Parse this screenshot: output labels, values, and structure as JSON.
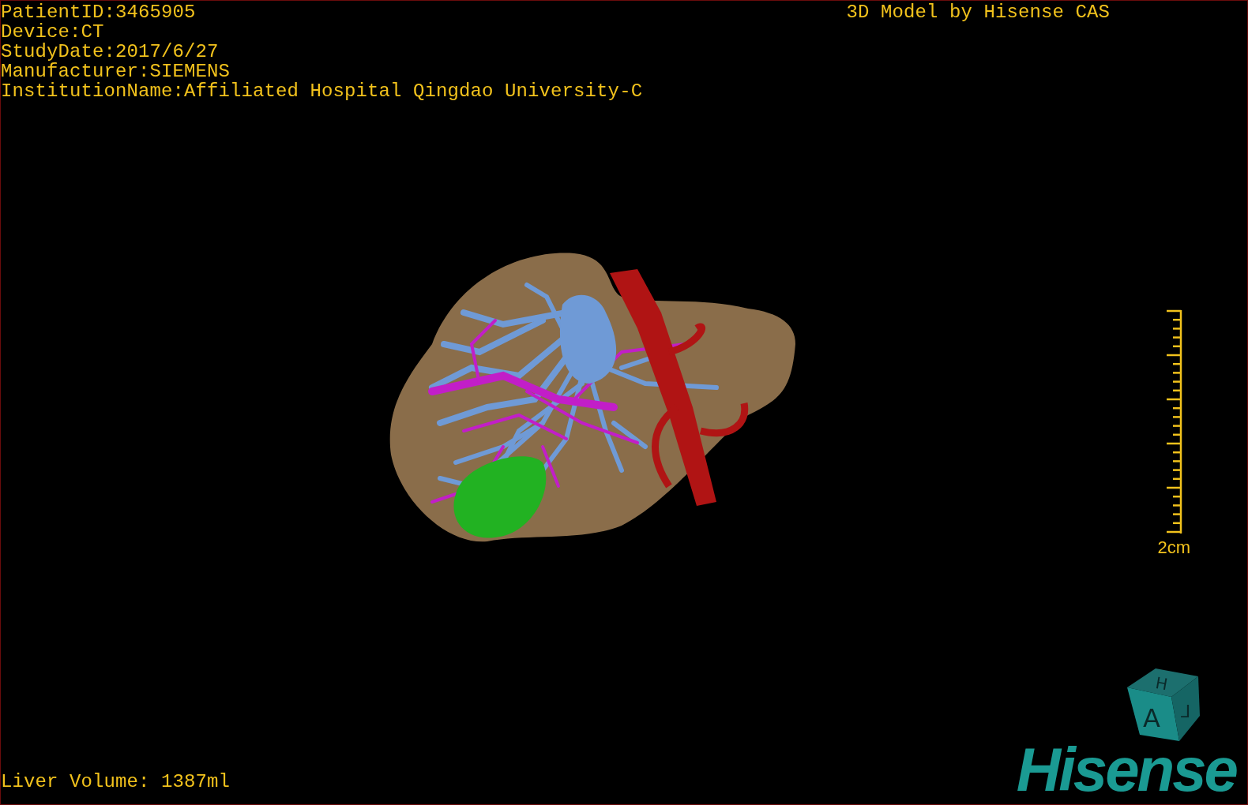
{
  "header": {
    "info_lines": [
      "PatientID:3465905",
      "Device:CT",
      "StudyDate:2017/6/27",
      "Manufacturer:SIEMENS",
      "InstitutionName:Affiliated Hospital Qingdao University-C"
    ],
    "title": "3D Model by Hisense CAS"
  },
  "scale_bar": {
    "label": "2cm"
  },
  "footer": {
    "volume": "Liver Volume: 1387ml"
  },
  "orientation_cube": {
    "top": "H",
    "front": "A",
    "side": "⅃"
  },
  "logo": "Hisense"
}
